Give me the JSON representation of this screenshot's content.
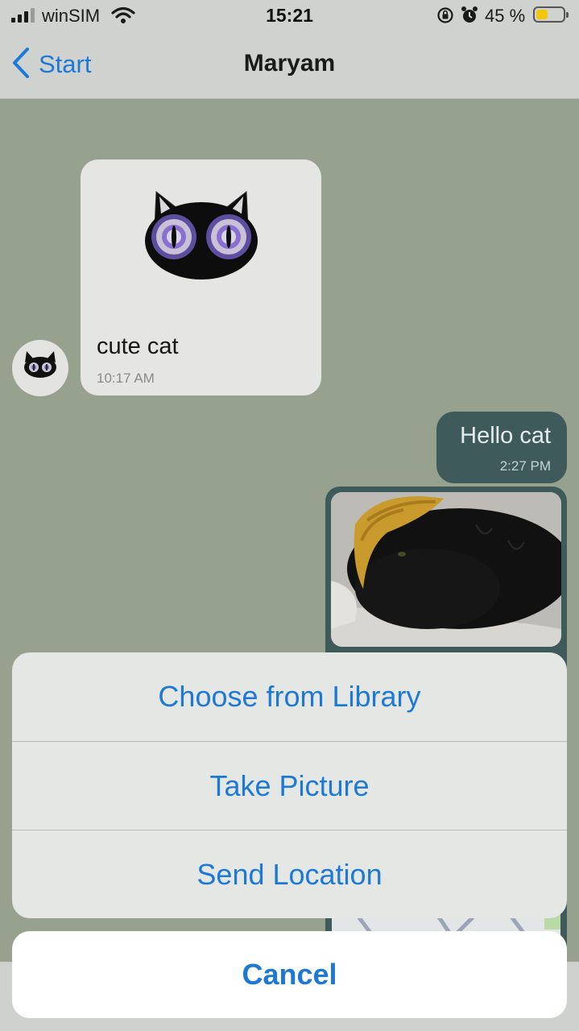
{
  "status_bar": {
    "carrier": "winSIM",
    "time": "15:21",
    "battery_percent": "45 %",
    "battery_level": 0.45,
    "icons": [
      "signal-icon",
      "wifi-icon",
      "rotation-lock-icon",
      "alarm-icon",
      "battery-icon"
    ]
  },
  "nav": {
    "back_label": "Start",
    "title": "Maryam"
  },
  "messages": [
    {
      "direction": "incoming",
      "type": "sticker",
      "sticker": "black-cat-sticker",
      "text": "cute cat",
      "time": "10:17 AM"
    },
    {
      "direction": "outgoing",
      "type": "text",
      "text": "Hello cat",
      "time": "2:27 PM"
    },
    {
      "direction": "outgoing",
      "type": "image",
      "image": "cat-photo"
    }
  ],
  "action_sheet": {
    "options": [
      {
        "label": "Choose from Library"
      },
      {
        "label": "Take Picture"
      },
      {
        "label": "Send Location"
      }
    ],
    "cancel_label": "Cancel"
  },
  "colors": {
    "accent": "#1d79d6",
    "chat_background": "#96a18e",
    "incoming_bubble": "#e5e5e3",
    "outgoing_bubble": "#3f5a5b",
    "battery_fill": "#f2c80f"
  }
}
